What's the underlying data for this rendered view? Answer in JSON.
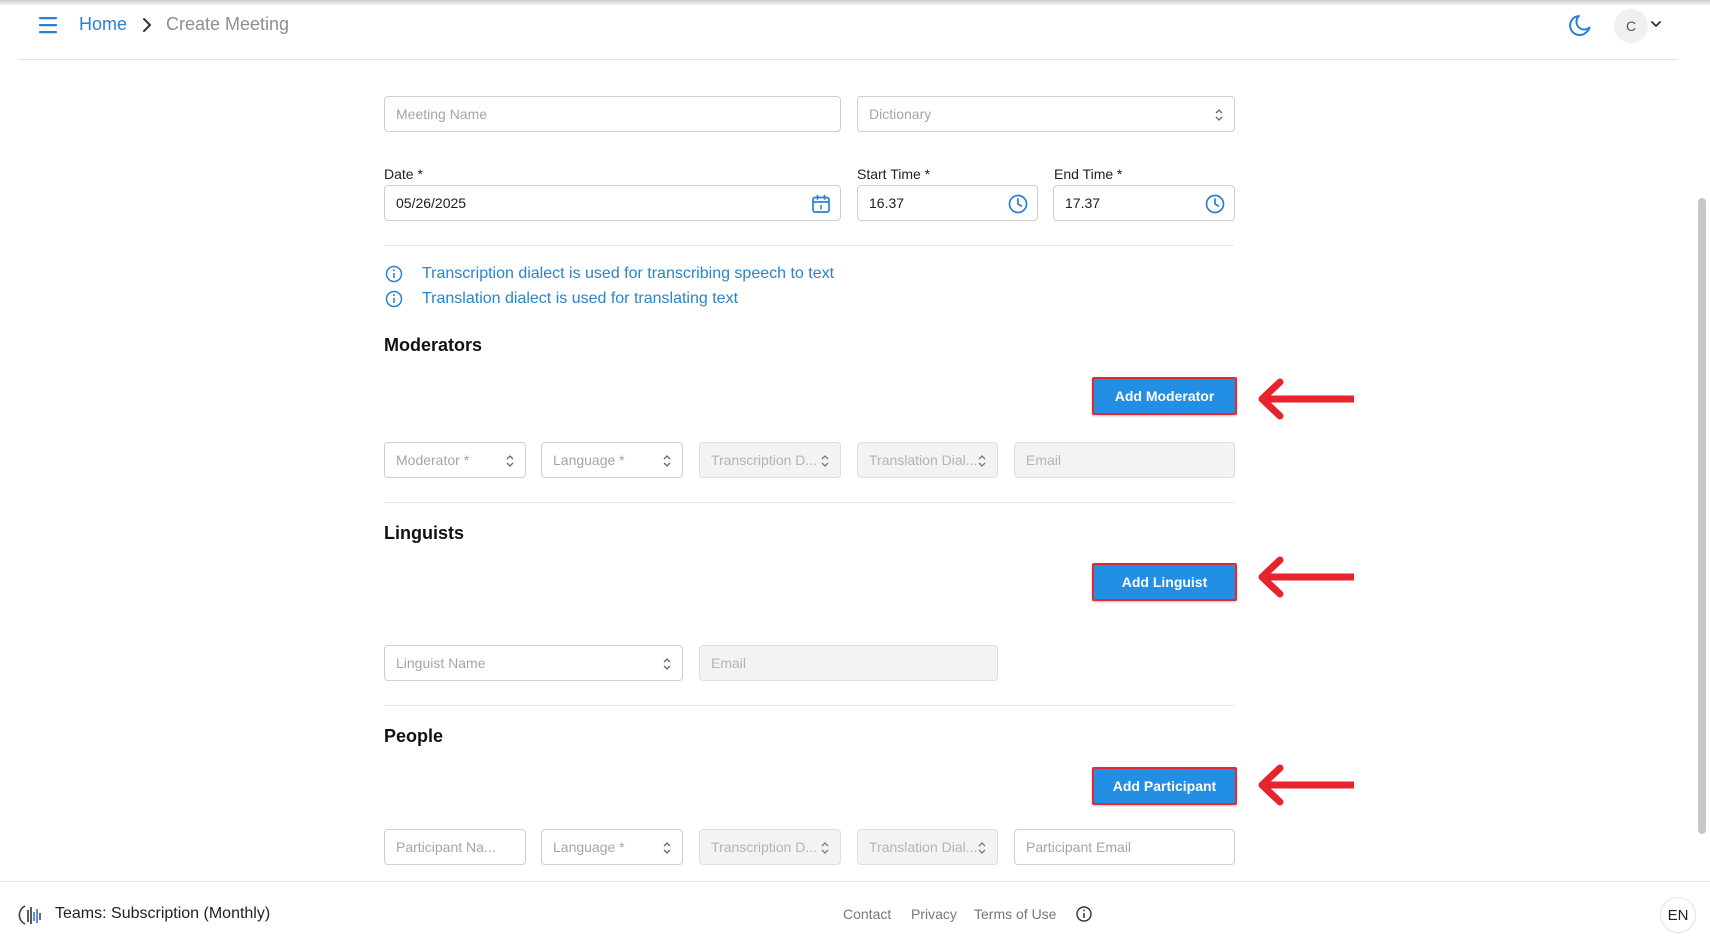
{
  "header": {
    "breadcrumb_home": "Home",
    "breadcrumb_current": "Create Meeting",
    "avatar_initial": "C",
    "icons": {
      "menu": "hamburger-icon",
      "theme": "moon-icon",
      "account": "chevron-down-icon"
    }
  },
  "form": {
    "meeting_name_placeholder": "Meeting Name",
    "dictionary_placeholder": "Dictionary",
    "date_label": "Date *",
    "date_value": "05/26/2025",
    "start_time_label": "Start Time *",
    "start_time_value": "16.37",
    "end_time_label": "End Time *",
    "end_time_value": "17.37"
  },
  "info": {
    "transcription_note": "Transcription dialect is used for transcribing speech to text",
    "translation_note": "Translation dialect is used for translating text"
  },
  "moderators": {
    "title": "Moderators",
    "add_button": "Add Moderator",
    "moderator_placeholder": "Moderator *",
    "language_placeholder": "Language *",
    "transcription_placeholder": "Transcription D...",
    "translation_placeholder": "Translation Dial...",
    "email_placeholder": "Email"
  },
  "linguists": {
    "title": "Linguists",
    "add_button": "Add Linguist",
    "name_placeholder": "Linguist Name",
    "email_placeholder": "Email"
  },
  "people": {
    "title": "People",
    "add_button": "Add Participant",
    "name_placeholder": "Participant Na...",
    "language_placeholder": "Language *",
    "transcription_placeholder": "Transcription D...",
    "translation_placeholder": "Translation Dial...",
    "email_placeholder": "Participant Email"
  },
  "footer": {
    "subscription": "Teams: Subscription (Monthly)",
    "contact": "Contact",
    "privacy": "Privacy",
    "terms": "Terms of Use",
    "language": "EN"
  },
  "colors": {
    "accent": "#238fe4",
    "link": "#2d7fcf",
    "highlight_border": "#e12b33",
    "annotation_arrow": "#e8232b"
  }
}
